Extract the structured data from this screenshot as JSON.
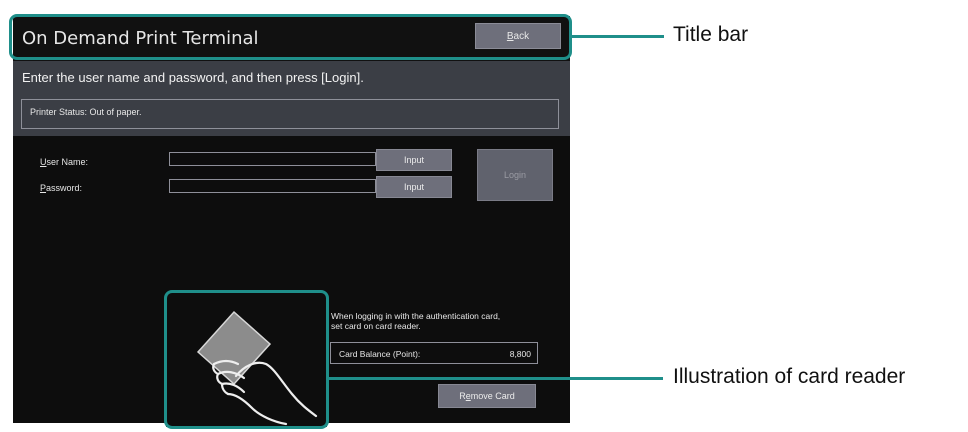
{
  "title_bar": {
    "app_title": "On Demand Print Terminal",
    "back_label_prefix": "",
    "back_label_underline": "B",
    "back_label_rest": "ack"
  },
  "instruction": "Enter the user name and password, and then press [Login].",
  "printer_status": "Printer Status: Out of paper.",
  "login_form": {
    "user_name": {
      "label_underline": "U",
      "label_rest": "ser Name:",
      "value": "",
      "input_button": "Input"
    },
    "password": {
      "label_underline": "P",
      "label_rest": "assword:",
      "value": "",
      "input_button": "Input"
    },
    "login_button": "Login"
  },
  "card_panel": {
    "message_line1": "When logging in with the authentication card,",
    "message_line2": "set card on card reader.",
    "balance_label": "Card Balance (Point):",
    "balance_value": "8,800",
    "remove_prefix": "R",
    "remove_underline": "e",
    "remove_rest": "move Card"
  },
  "callouts": {
    "title_bar": "Title bar",
    "card_reader": "Illustration of card reader"
  },
  "colors": {
    "highlight": "#1f8f8a",
    "screen_bg": "#0d0d0d",
    "button_bg": "#6e6f7b"
  }
}
